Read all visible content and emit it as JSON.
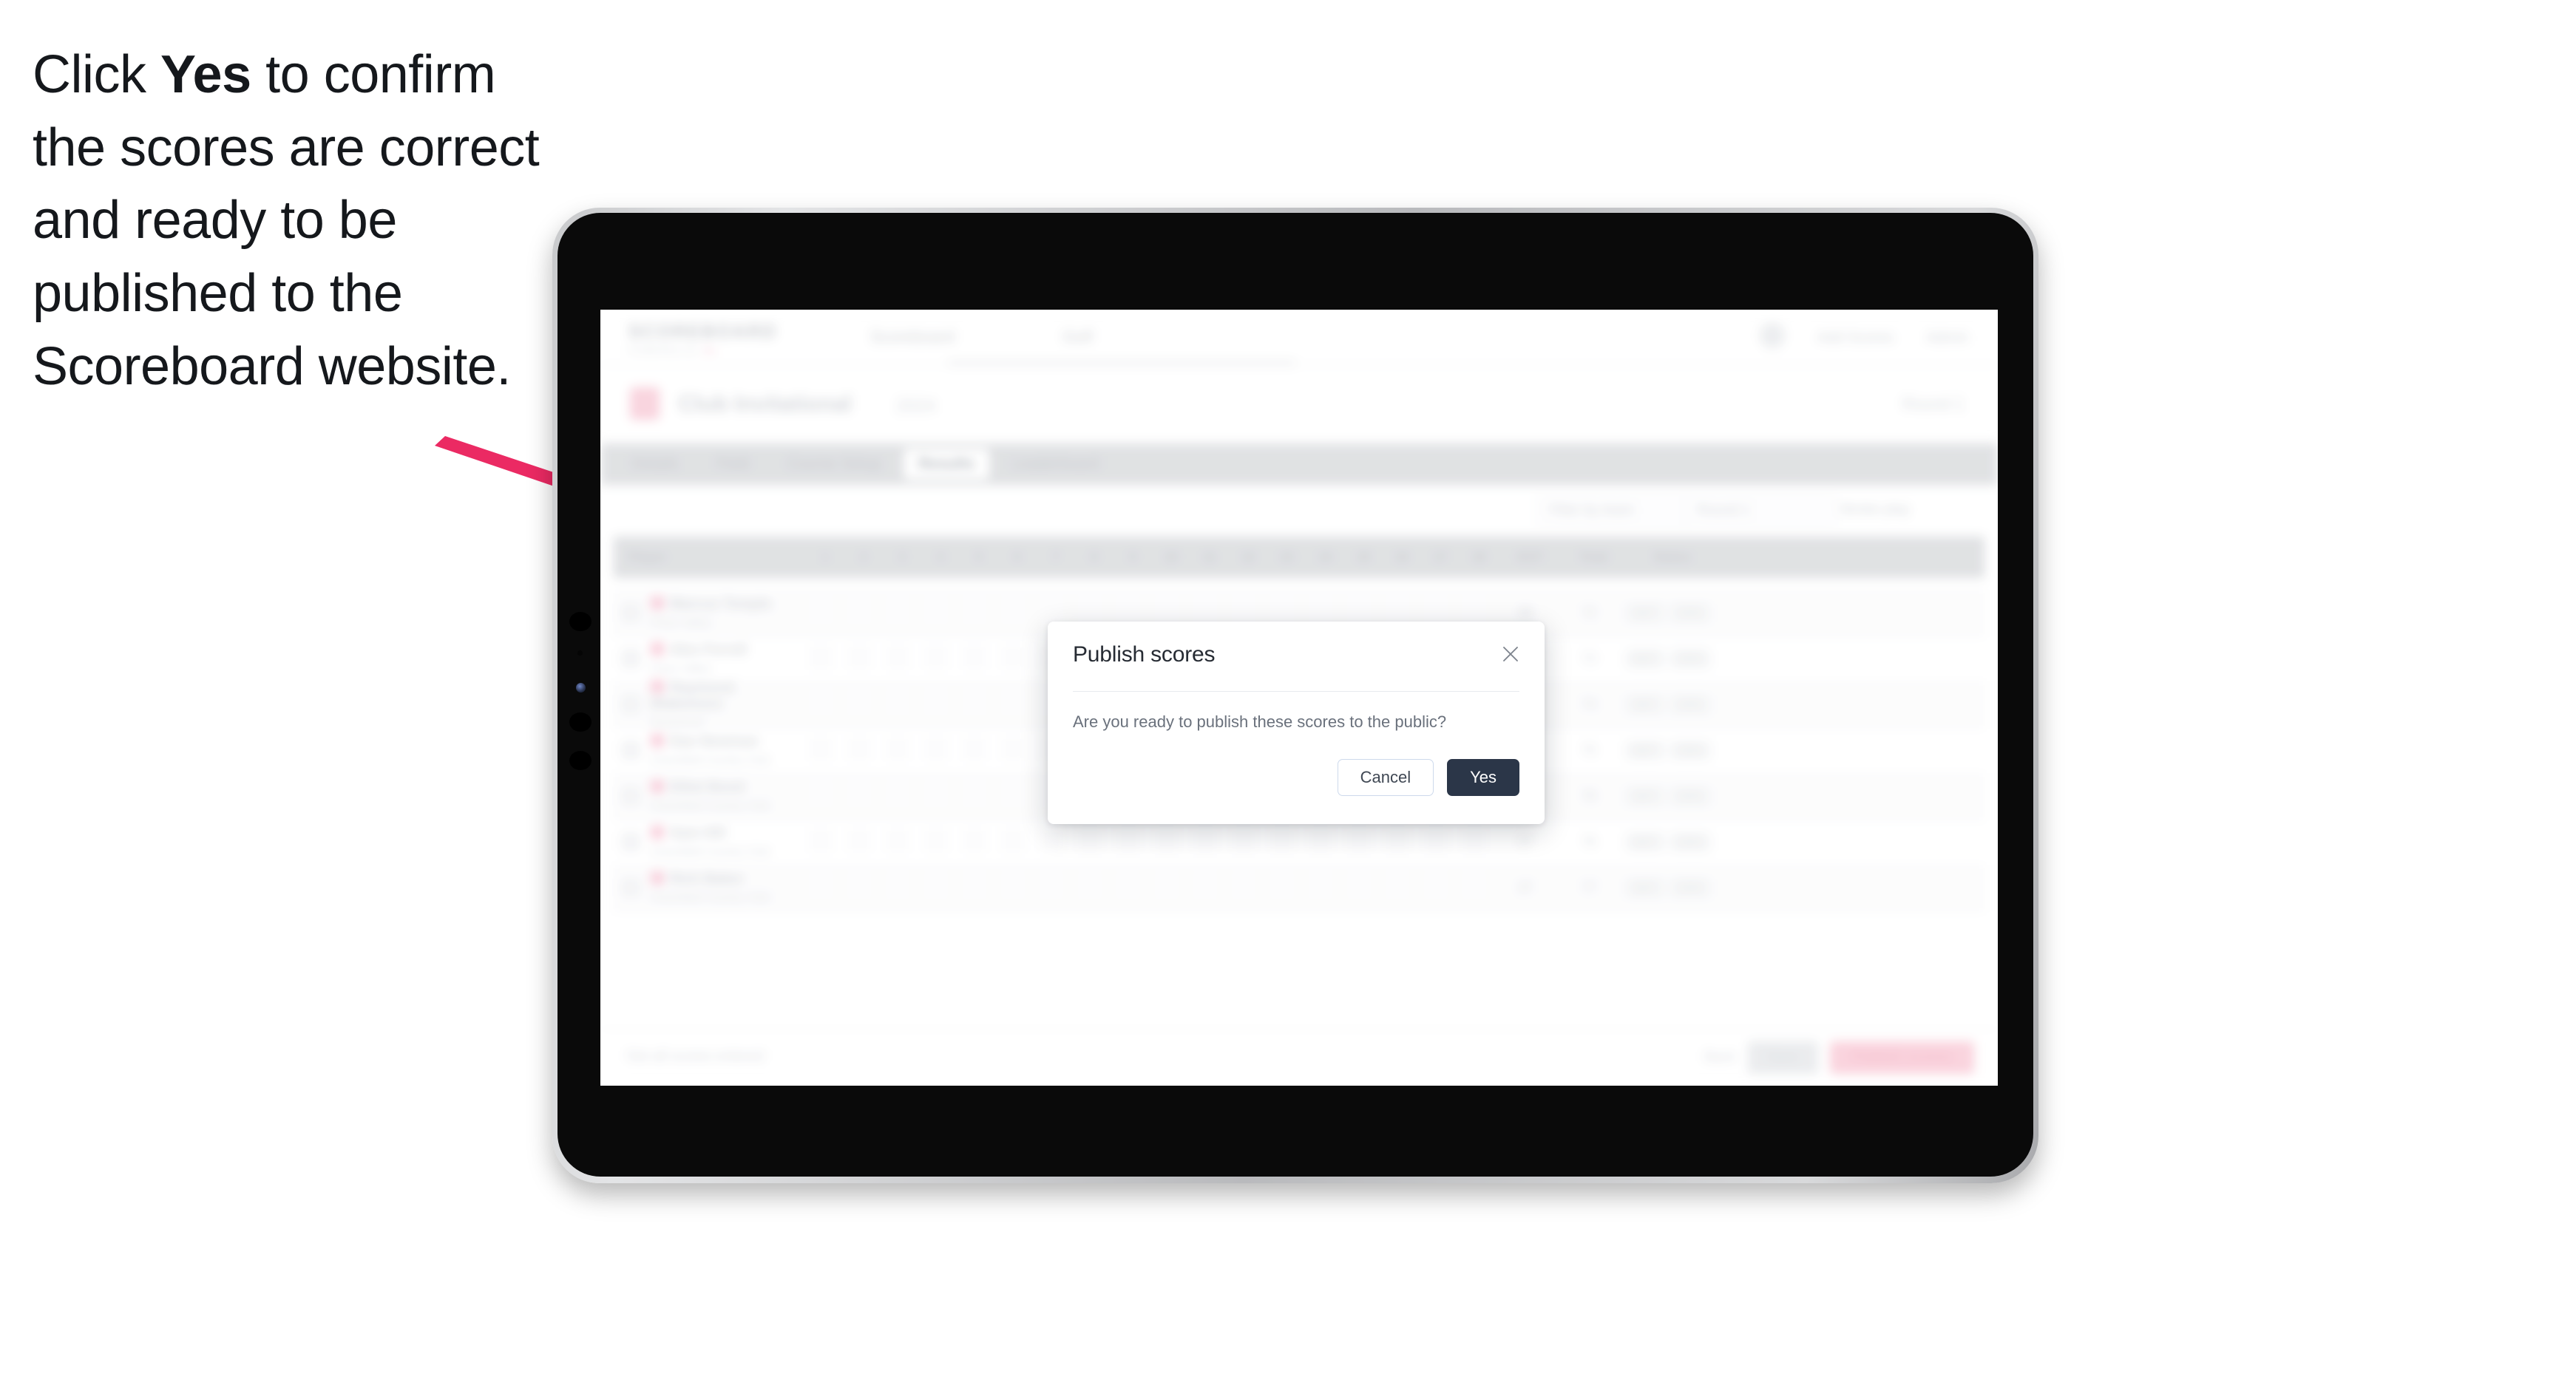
{
  "caption": {
    "before": "Click ",
    "bold": "Yes",
    "after": " to confirm the scores are correct and ready to be published to the Scoreboard website."
  },
  "annotation": {
    "arrow_color": "#EB2A63",
    "points_to": "yes-button"
  },
  "device": {
    "type": "tablet",
    "bezel_color": "#c9cacc",
    "body_color": "#0a0a0a"
  },
  "app": {
    "nav": {
      "brand": "SCOREBOARD",
      "brand_sub_left": "POWERED BY",
      "brand_sub_mark": "",
      "links": [
        "Scoreboard",
        "Golf"
      ],
      "right_items": [
        "Add Scores",
        "Admin"
      ],
      "avatar": "avatar"
    },
    "event": {
      "title": "Club Invitational",
      "subtitle": "2024",
      "right_label": "Round 1"
    },
    "tabs": [
      {
        "label": "Details",
        "active": false
      },
      {
        "label": "Field",
        "active": false
      },
      {
        "label": "Course Setup",
        "active": false
      },
      {
        "label": "Results",
        "active": true
      },
      {
        "label": "Leaderboard",
        "active": false
      }
    ],
    "toolbar": {
      "controls": [
        "Filter by team",
        "Round 1",
        "Stroke play"
      ]
    },
    "table": {
      "columns": [
        "Player",
        "1",
        "2",
        "3",
        "4",
        "5",
        "6",
        "7",
        "8",
        "9",
        "10",
        "11",
        "12",
        "13",
        "14",
        "15",
        "16",
        "17",
        "18",
        "OUT",
        "Total",
        "Status"
      ],
      "rows": [
        {
          "name": "Marcus Temple",
          "club": "Pines Valley",
          "scores": [
            "4",
            "5",
            "3",
            "4",
            "4",
            "3",
            "5",
            "4",
            "4",
            "4",
            "3",
            "5",
            "4",
            "4",
            "3",
            "4",
            "5",
            "4"
          ],
          "out": "36",
          "total": "72",
          "status": [
            "NET",
            "GRS"
          ]
        },
        {
          "name": "Alex Ferrell",
          "club": "Pines Valley",
          "scores": [
            "4",
            "4",
            "4",
            "5",
            "3",
            "4",
            "4",
            "4",
            "5",
            "3",
            "4",
            "4",
            "5",
            "4",
            "4",
            "3",
            "4",
            "4"
          ],
          "out": "36",
          "total": "73",
          "status": [
            "NET",
            "GRS"
          ]
        },
        {
          "name": "Raymond Blakemore",
          "club": "Rosewood",
          "scores": [
            "5",
            "4",
            "3",
            "4",
            "4",
            "4",
            "5",
            "3",
            "4",
            "4",
            "4",
            "5",
            "3",
            "4",
            "4",
            "4",
            "5",
            "4"
          ],
          "out": "36",
          "total": "74",
          "status": [
            "NET",
            "GRS"
          ]
        },
        {
          "name": "Dan Newman",
          "club": "Greenfield Country Club",
          "scores": [
            "4",
            "4",
            "4",
            "4",
            "5",
            "3",
            "4",
            "4",
            "4",
            "5",
            "4",
            "4",
            "3",
            "5",
            "4",
            "4",
            "4",
            "4"
          ],
          "out": "36",
          "total": "75",
          "status": [
            "NET",
            "GRS"
          ]
        },
        {
          "name": "Elliot Bond",
          "club": "Greenfield Country Club",
          "scores": [
            "4",
            "5",
            "4",
            "3",
            "4",
            "4",
            "4",
            "5",
            "4",
            "4",
            "4",
            "3",
            "5",
            "4",
            "4",
            "4",
            "4",
            "5"
          ],
          "out": "37",
          "total": "76",
          "status": [
            "NET",
            "GRS"
          ]
        },
        {
          "name": "Sam Hill",
          "club": "Greenfield Country Club",
          "scores": [
            "5",
            "4",
            "4",
            "4",
            "3",
            "5",
            "4",
            "4",
            "4",
            "4",
            "5",
            "4",
            "3",
            "4",
            "4",
            "5",
            "4",
            "4"
          ],
          "out": "37",
          "total": "76",
          "status": [
            "NET",
            "GRS"
          ]
        },
        {
          "name": "Rich Baker",
          "club": "Greenfield Country Club",
          "scores": [
            "4",
            "4",
            "5",
            "4",
            "4",
            "4",
            "3",
            "4",
            "5",
            "4",
            "4",
            "4",
            "4",
            "5",
            "3",
            "4",
            "4",
            "4"
          ],
          "out": "37",
          "total": "77",
          "status": [
            "NET",
            "GRS"
          ]
        }
      ]
    },
    "footer": {
      "note": "Not all scores entered",
      "link": "Back",
      "secondary_button": "Save",
      "primary_button": "Publish scores"
    }
  },
  "modal": {
    "title": "Publish scores",
    "message": "Are you ready to publish these scores to the public?",
    "close_icon": "close-icon",
    "cancel_label": "Cancel",
    "confirm_label": "Yes",
    "confirm_color": "#2b3648"
  }
}
